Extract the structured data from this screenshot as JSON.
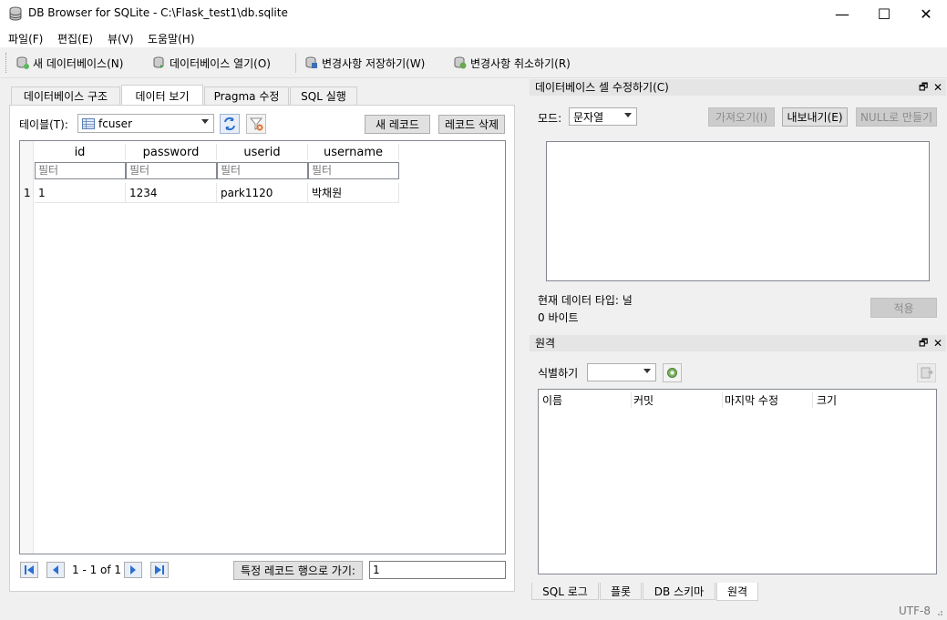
{
  "window": {
    "title": "DB Browser for SQLite - C:\\Flask_test1\\db.sqlite",
    "minimize": "—",
    "maximize": "☐",
    "close": "✕"
  },
  "menu": [
    "파일(F)",
    "편집(E)",
    "뷰(V)",
    "도움말(H)"
  ],
  "toolbar": {
    "new_db": "새 데이터베이스(N)",
    "open_db": "데이터베이스 열기(O)",
    "write_changes": "변경사항 저장하기(W)",
    "revert_changes": "변경사항 취소하기(R)"
  },
  "tabs": [
    "데이터베이스 구조",
    "데이터 보기",
    "Pragma 수정",
    "SQL 실행"
  ],
  "active_tab": "데이터 보기",
  "browse": {
    "table_label": "테이블(T):",
    "table_selected": "fcuser",
    "new_record": "새 레코드",
    "delete_record": "레코드 삭제",
    "columns": [
      "id",
      "password",
      "userid",
      "username"
    ],
    "filter_placeholder": "필터",
    "rows": [
      {
        "rownum": "1",
        "cells": [
          "1",
          "1234",
          "park1120",
          "박채원"
        ]
      }
    ],
    "nav_text": "1 - 1 of 1",
    "goto_label": "특정 레코드 행으로 가기:",
    "goto_value": "1"
  },
  "edit_cell": {
    "title": "데이터베이스 셀 수정하기(C)",
    "mode_label": "모드:",
    "mode_value": "문자열",
    "import": "가져오기(I)",
    "export": "내보내기(E)",
    "set_null": "NULL로 만들기",
    "type_info": "현재 데이터 타입: 널",
    "size_info": "0 바이트",
    "apply": "적용"
  },
  "remote": {
    "title": "원격",
    "identity_label": "식별하기",
    "columns": [
      "이름",
      "커밋",
      "마지막 수정",
      "크기"
    ]
  },
  "bottom_tabs": [
    "SQL 로그",
    "플롯",
    "DB 스키마",
    "원격"
  ],
  "status": {
    "encoding": "UTF-8"
  },
  "dock_float": "🗗",
  "dock_close": "✕"
}
